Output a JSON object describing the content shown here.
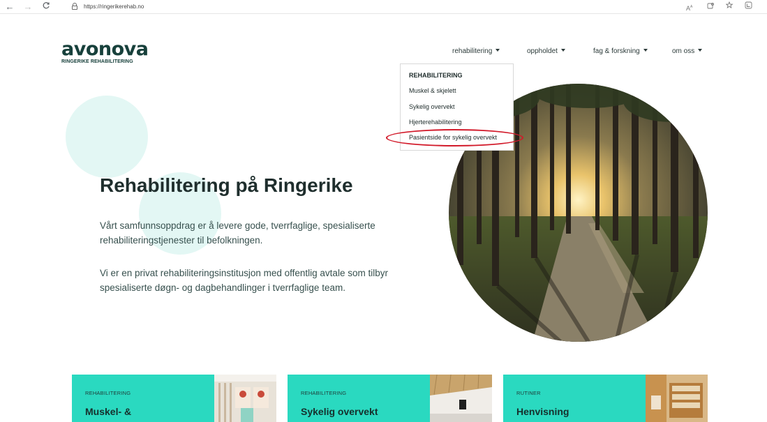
{
  "browser": {
    "url": "https://ringerikerehab.no",
    "back_icon": "←",
    "forward_icon": "→",
    "reload_icon": "C"
  },
  "logo": {
    "wordmark": "avonova",
    "subtitle": "RINGERIKE REHABILITERING"
  },
  "nav": {
    "items": [
      {
        "label": "rehabilitering"
      },
      {
        "label": "oppholdet"
      },
      {
        "label": "fag & forskning"
      },
      {
        "label": "om oss"
      }
    ]
  },
  "dropdown": {
    "heading": "REHABILITERING",
    "items": [
      {
        "label": "Muskel & skjelett"
      },
      {
        "label": "Sykelig overvekt"
      },
      {
        "label": "Hjerterehabilitering"
      },
      {
        "label": "Pasientside for sykelig overvekt",
        "highlighted": true
      }
    ]
  },
  "hero": {
    "title": "Rehabilitering på Ringerike",
    "paragraph1_line1": "Vårt samfunnsoppdrag er å levere gode, tverrfaglige, spesialiserte",
    "paragraph1_line2": "rehabiliteringstjenester til befolkningen.",
    "paragraph2_line1": "Vi er en privat rehabiliteringsinstitusjon med offentlig avtale som tilbyr",
    "paragraph2_line2": "spesialiserte døgn- og dagbehandlinger i tverrfaglige team."
  },
  "cards": [
    {
      "category": "REHABILITERING",
      "title": "Muskel- &"
    },
    {
      "category": "REHABILITERING",
      "title": "Sykelig overvekt"
    },
    {
      "category": "RUTINER",
      "title": "Henvisning"
    }
  ],
  "colors": {
    "brand_dark": "#17403b",
    "accent_teal": "#2ad9c0",
    "deco_circle": "#e3f7f4",
    "highlight_red": "#d21a2a"
  }
}
